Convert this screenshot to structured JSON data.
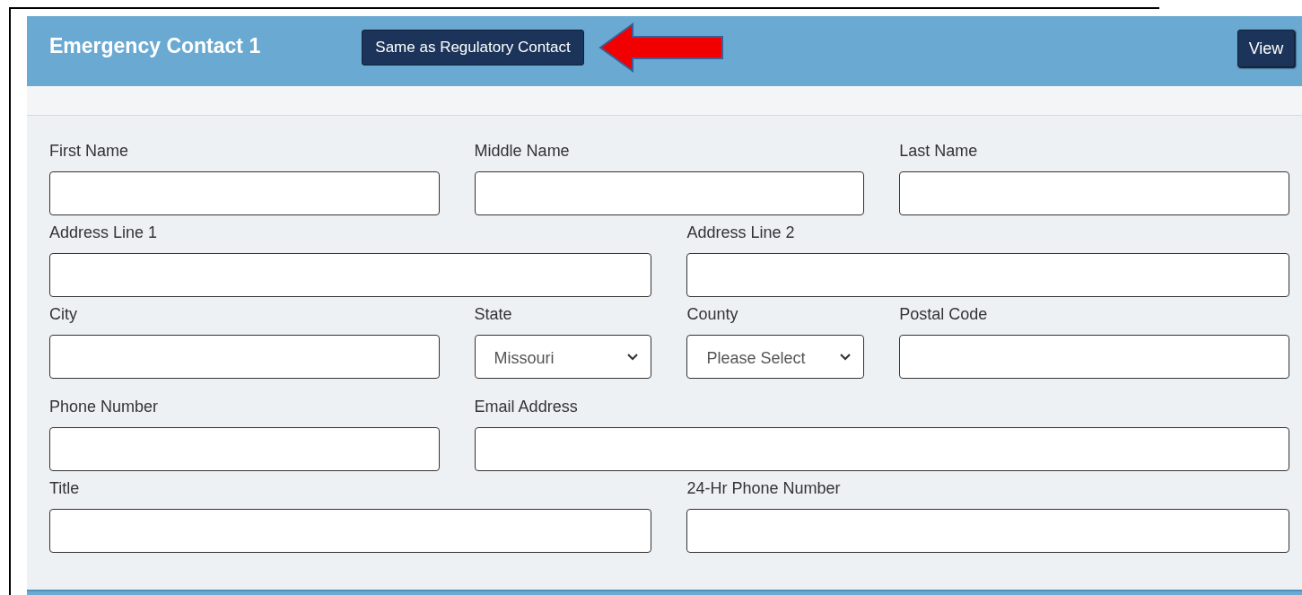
{
  "header": {
    "title": "Emergency Contact 1",
    "copy_button": "Same as Regulatory Contact",
    "view_button": "View"
  },
  "rows": [
    [
      {
        "label": "First Name",
        "kind": "text"
      },
      {
        "label": "Middle Name",
        "kind": "text"
      },
      {
        "label": "Last Name",
        "kind": "text"
      }
    ],
    [
      {
        "label": "Address Line 1",
        "kind": "text"
      },
      {
        "label": "Address Line 2",
        "kind": "text"
      }
    ],
    [
      {
        "label": "City",
        "kind": "text"
      },
      {
        "label": "State",
        "kind": "select",
        "value": "Missouri"
      },
      {
        "label": "County",
        "kind": "select",
        "value": "Please Select"
      },
      {
        "label": "Postal Code",
        "kind": "text"
      }
    ],
    [
      {
        "label": "Phone Number",
        "kind": "text"
      },
      {
        "label": "Email Address",
        "kind": "text"
      }
    ],
    [
      {
        "label": "Title",
        "kind": "text"
      },
      {
        "label": "24-Hr Phone Number",
        "kind": "text"
      }
    ]
  ]
}
